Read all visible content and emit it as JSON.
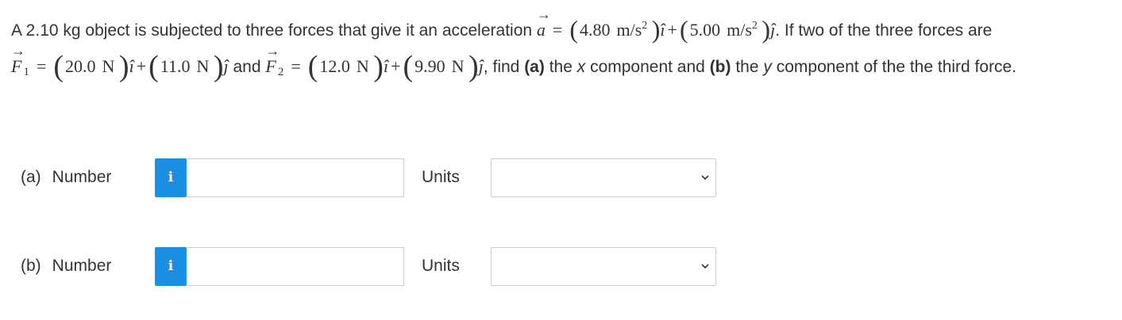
{
  "question": {
    "t1": "A 2.10 kg object is subjected to three forces that give it an acceleration ",
    "a_symbol": "a",
    "eq": "=",
    "a_x": "4.80",
    "a_unit": "m/s",
    "a_unit_exp": "2",
    "i_hat": "î",
    "plus": "+",
    "a_y": "5.00",
    "j_hat": "ĵ",
    "t2": ". If two of the three forces are ",
    "f_symbol": "F",
    "f1_sub": "1",
    "f1_x": "20.0",
    "f1_y": "11.0",
    "newton": "N",
    "t3": " and ",
    "f2_sub": "2",
    "f2_x": "12.0",
    "f2_y": "9.90",
    "t4": ", find ",
    "part_a_bold": "(a)",
    "t5": " the ",
    "x_ital": "x",
    "t6": " component and ",
    "part_b_bold": "(b)",
    "t7": " the ",
    "y_ital": "y",
    "t8": " component of the the third force."
  },
  "answers": [
    {
      "part": "(a)",
      "label": "Number",
      "info_icon": "i",
      "value": "",
      "units_label": "Units",
      "units_selected": ""
    },
    {
      "part": "(b)",
      "label": "Number",
      "info_icon": "i",
      "value": "",
      "units_label": "Units",
      "units_selected": ""
    }
  ],
  "colors": {
    "info_button": "#1a8fe3",
    "text": "#333333",
    "border": "#cccccc"
  },
  "icons": {
    "info": "info-icon",
    "dropdown": "chevron-down-icon"
  }
}
